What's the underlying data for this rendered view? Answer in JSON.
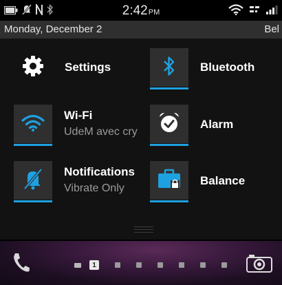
{
  "status": {
    "time": "2:42",
    "ampm": "PM",
    "left_icons": [
      "battery-icon",
      "mute-icon",
      "nfc-icon",
      "bluetooth-icon"
    ],
    "right_icons": [
      "wifi-icon",
      "data-icon",
      "signal-icon"
    ]
  },
  "date_bar": {
    "date": "Monday, December 2",
    "carrier": "Bel"
  },
  "tiles": {
    "settings": {
      "label": "Settings",
      "icon": "gear-icon"
    },
    "bluetooth": {
      "label": "Bluetooth",
      "icon": "bluetooth-icon",
      "active": true
    },
    "wifi": {
      "label": "Wi-Fi",
      "sub": "UdeM avec cry",
      "icon": "wifi-icon",
      "active": true
    },
    "alarm": {
      "label": "Alarm",
      "icon": "alarm-clock-icon"
    },
    "notifications": {
      "label": "Notifications",
      "sub": "Vibrate Only",
      "icon": "muted-bell-icon",
      "active": true
    },
    "balance": {
      "label": "Balance",
      "icon": "briefcase-lock-icon",
      "active": true
    }
  },
  "dock": {
    "message_count": "1",
    "icons": [
      "phone-icon",
      "camera-icon"
    ]
  },
  "colors": {
    "accent": "#1ea1e0",
    "panel_bg": "#121212",
    "date_bar_bg": "#2f2f2f"
  }
}
